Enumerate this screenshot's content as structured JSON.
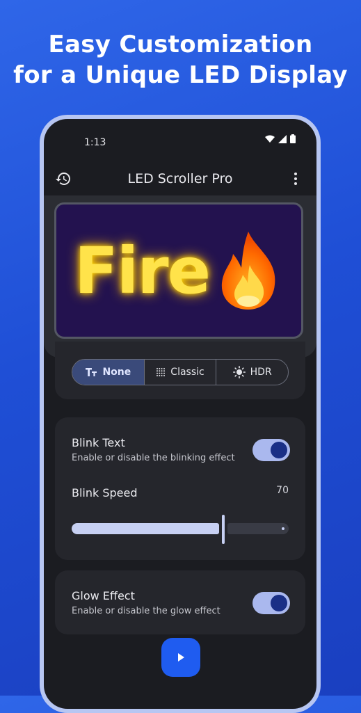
{
  "headline": {
    "line1": "Easy Customization",
    "line2": "for a Unique LED Display"
  },
  "status_bar": {
    "time": "1:13",
    "icons": [
      "wifi-icon",
      "signal-icon",
      "battery-icon"
    ]
  },
  "app_bar": {
    "title": "LED Scroller Pro",
    "left_icon": "history-icon",
    "right_icon": "more-vert-icon"
  },
  "preview": {
    "text": "Fire",
    "emoji": "🔥",
    "text_color": "#ffe34a",
    "background_color": "#23124f"
  },
  "mode_selector": {
    "options": [
      {
        "label": "None",
        "icon": "text-format-icon",
        "selected": true
      },
      {
        "label": "Classic",
        "icon": "dot-grid-icon",
        "selected": false
      },
      {
        "label": "HDR",
        "icon": "brightness-icon",
        "selected": false
      }
    ]
  },
  "blink": {
    "title": "Blink Text",
    "subtitle": "Enable or disable the blinking effect",
    "enabled": true,
    "speed_label": "Blink Speed",
    "speed_value": "70",
    "speed_fraction": 0.7
  },
  "glow": {
    "title": "Glow Effect",
    "subtitle": "Enable or disable the glow effect",
    "enabled": true
  },
  "fab": {
    "icon": "play-icon"
  },
  "colors": {
    "accent": "#1f5cf0",
    "toggle_track": "#aab8ee",
    "toggle_knob": "#1a2f86"
  }
}
